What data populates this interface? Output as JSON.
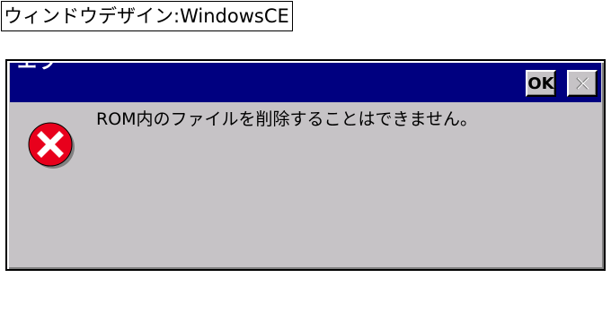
{
  "caption": {
    "text": "ウィンドウデザイン:WindowsCE"
  },
  "dialog": {
    "title": "エラ",
    "ok_label": "OK",
    "close_glyph": "×",
    "message": "ROM内のファイルを削除することはできません。",
    "icon": "error-icon",
    "colors": {
      "titlebar": "#000080",
      "face": "#c6c3c6",
      "icon_red": "#e8001c"
    }
  }
}
